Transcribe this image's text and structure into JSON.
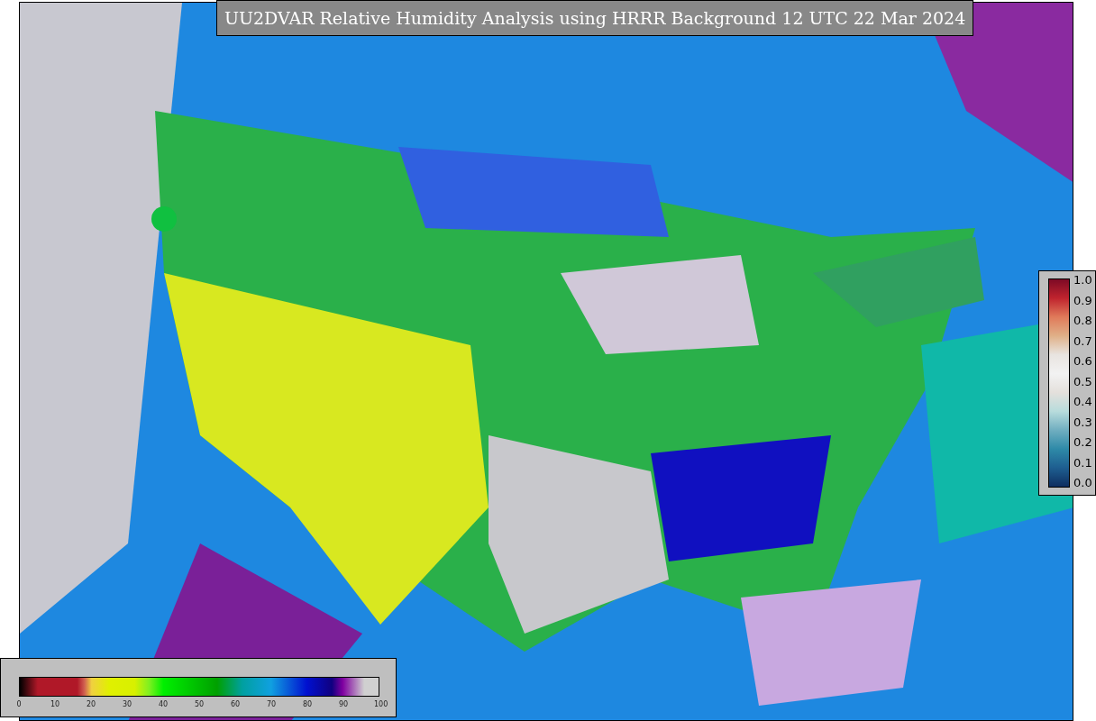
{
  "title": "UU2DVAR Relative Humidity Analysis using HRRR Background 12 UTC 22 Mar 2024",
  "station_colorbar": {
    "ticks": [
      "1.0",
      "0.9",
      "0.8",
      "0.7",
      "0.6",
      "0.5",
      "0.4",
      "0.3",
      "0.2",
      "0.1",
      "0.0"
    ]
  },
  "humidity_colorbar": {
    "ticks": [
      "0",
      "10",
      "20",
      "30",
      "40",
      "50",
      "60",
      "70",
      "80",
      "90",
      "100"
    ]
  }
}
